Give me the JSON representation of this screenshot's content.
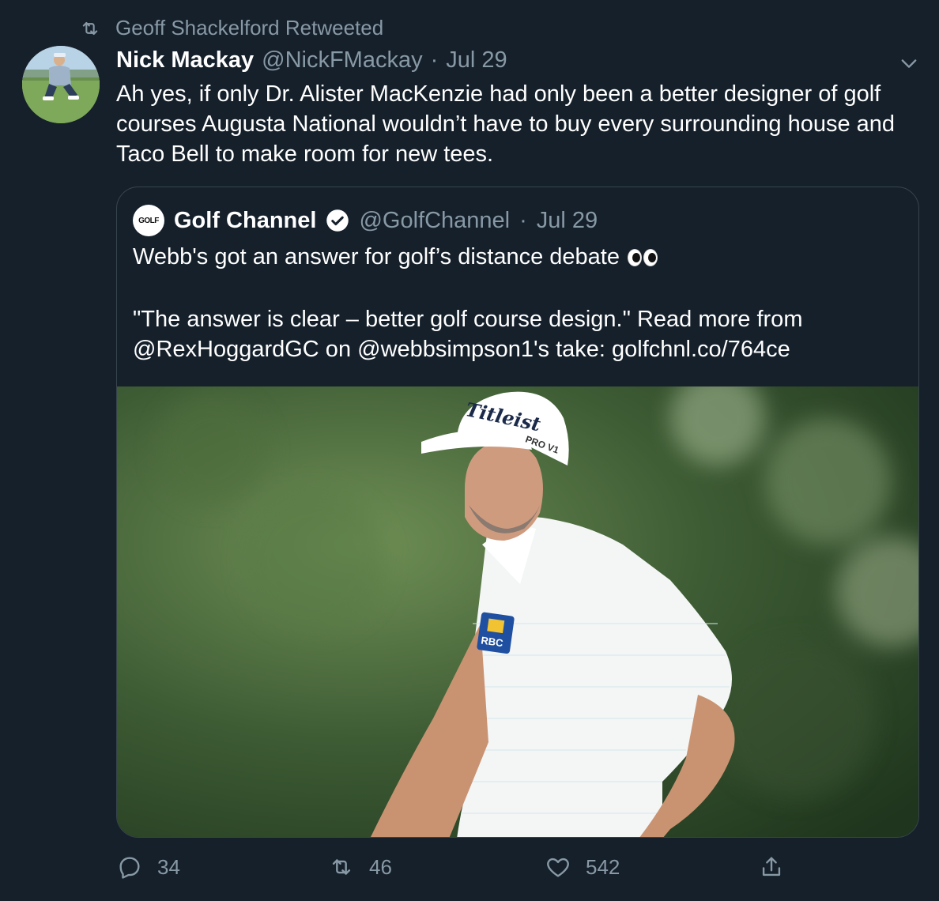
{
  "retweet_header": {
    "text": "Geoff Shackelford Retweeted"
  },
  "tweet": {
    "author_name": "Nick Mackay",
    "author_handle": "@NickFMackay",
    "separator": "·",
    "date": "Jul 29",
    "text": "Ah yes, if only Dr. Alister MacKenzie had only been a better designer of golf courses Augusta National wouldn’t have to buy every surrounding house and Taco Bell to make room for new tees."
  },
  "quoted_tweet": {
    "logo_text": "GOLF",
    "author_name": "Golf Channel",
    "author_handle": "@GolfChannel",
    "separator": "·",
    "date": "Jul 29",
    "line1": "Webb's got an answer for golf’s distance debate",
    "paragraph": "\"The answer is clear – better golf course design.\" Read more from @RexHoggardGC on @webbsimpson1's take: golfchnl.co/764ce",
    "photo": {
      "cap_logo": "Titleist",
      "cap_side": "PRO V1",
      "sleeve_logo": "RBC"
    }
  },
  "actions": {
    "reply_count": "34",
    "retweet_count": "46",
    "like_count": "542"
  },
  "colors": {
    "background": "#15202b",
    "secondary_text": "#8899a6",
    "border": "#38444d"
  }
}
